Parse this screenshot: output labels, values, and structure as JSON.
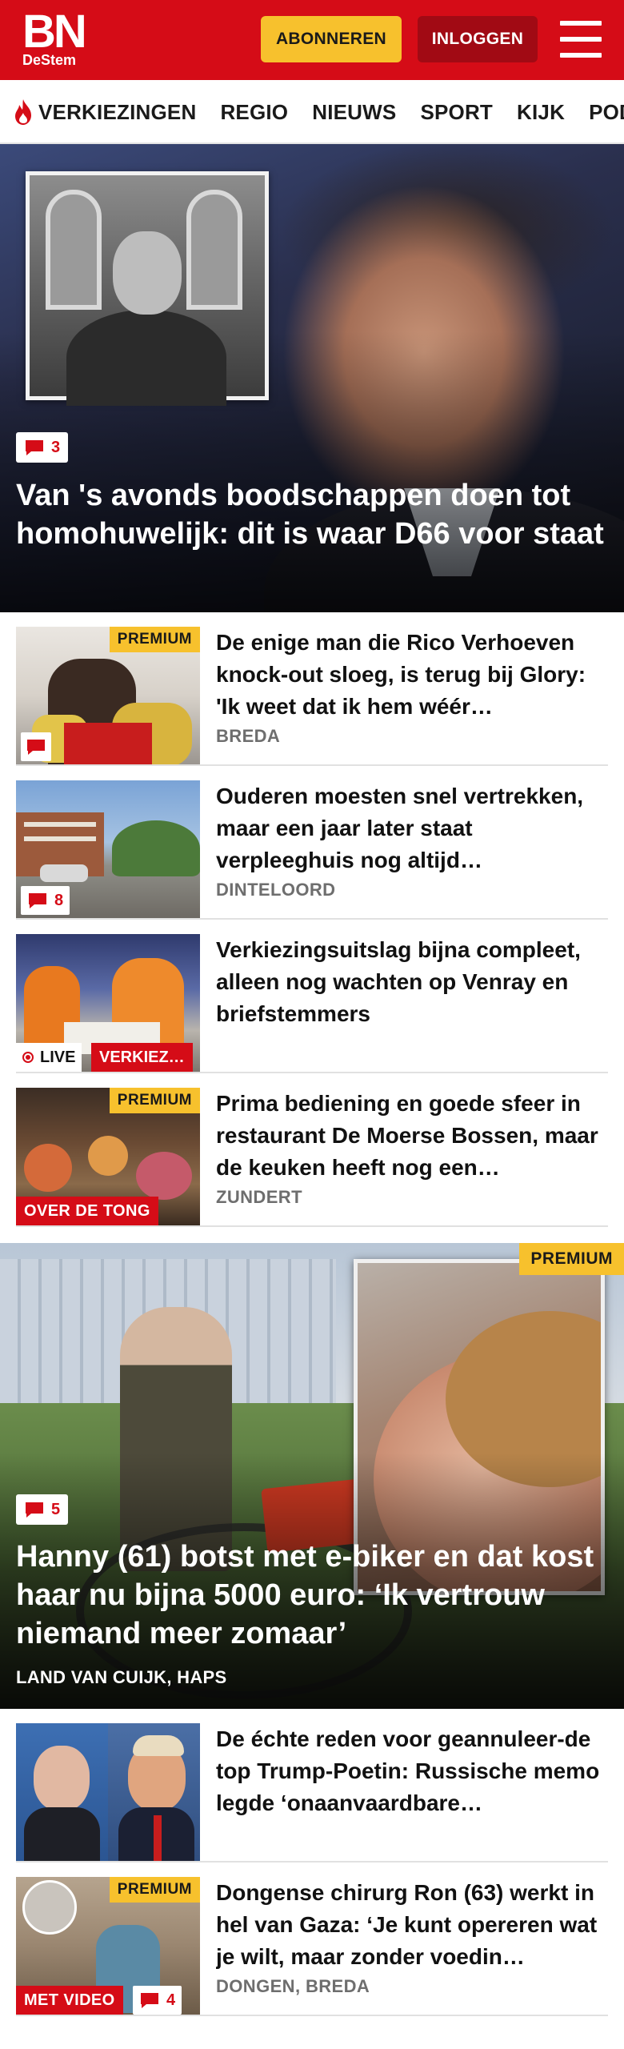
{
  "header": {
    "logo_main": "BN",
    "logo_sub": "DeStem",
    "subscribe_label": "ABONNEREN",
    "login_label": "INLOGGEN",
    "brand_color": "#d50c17"
  },
  "nav": {
    "items": [
      "VERKIEZINGEN",
      "REGIO",
      "NIEUWS",
      "SPORT",
      "KIJK",
      "PODCAST"
    ]
  },
  "hero": {
    "comments": "3",
    "title": "Van 's avonds boodschappen doen tot homohuwelijk: dit is waar D66 voor staat"
  },
  "articles": [
    {
      "title": "De enige man die Rico Verhoeven knock-out sloeg, is terug bij Glory: 'Ik weet dat ik hem wéér…",
      "location": "BREDA",
      "premium": "PREMIUM",
      "comments": ""
    },
    {
      "title": "Ouderen moesten snel vertrekken, maar een jaar later staat verpleeghuis nog altijd…",
      "location": "DINTELOORD",
      "comments": "8"
    },
    {
      "title": "Verkiezingsuitslag bijna compleet, alleen nog wachten op Venray en briefstemmers",
      "live_label": "LIVE",
      "category": "VERKIEZ…"
    },
    {
      "title": "Prima bediening en goede sfeer in restaurant De Moerse Bossen, maar de keuken heeft nog een…",
      "location": "ZUNDERT",
      "premium": "PREMIUM",
      "category": "OVER DE TONG"
    }
  ],
  "hero2": {
    "premium": "PREMIUM",
    "comments": "5",
    "title": "Hanny (61) botst met e-biker en dat kost haar nu bijna 5000 euro: ‘Ik vertrouw niemand meer zomaar’",
    "location": "LAND VAN CUIJK, HAPS"
  },
  "articles2": [
    {
      "title": "De échte reden voor geannuleer-de top Trump-Poetin: Russische memo legde ‘onaanvaardbare…"
    },
    {
      "title": "Dongense chirurg Ron (63) werkt in hel van Gaza: ‘Je kunt opereren wat je wilt, maar zonder voedin…",
      "location": "DONGEN, BREDA",
      "premium": "PREMIUM",
      "category": "MET VIDEO",
      "comments": "4"
    }
  ]
}
